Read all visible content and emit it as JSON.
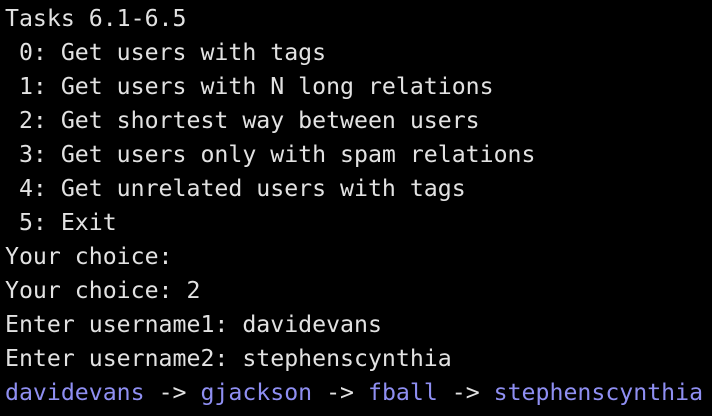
{
  "terminal": {
    "text_color": "#e2e2e2",
    "background_color": "#000000",
    "link_color": "#8f8ff2",
    "lines": [
      "Tasks 6.1-6.5",
      " 0: Get users with tags",
      " 1: Get users with N long relations",
      " 2: Get shortest way between users",
      " 3: Get users only with spam relations",
      " 4: Get unrelated users with tags",
      " 5: Exit",
      "Your choice:",
      "Your choice: 2",
      "Enter username1: davidevans",
      "Enter username2: stephenscynthia"
    ],
    "path": {
      "nodes": [
        "davidevans",
        "gjackson",
        "fball",
        "stephenscynthia"
      ],
      "arrow": " -> "
    }
  }
}
